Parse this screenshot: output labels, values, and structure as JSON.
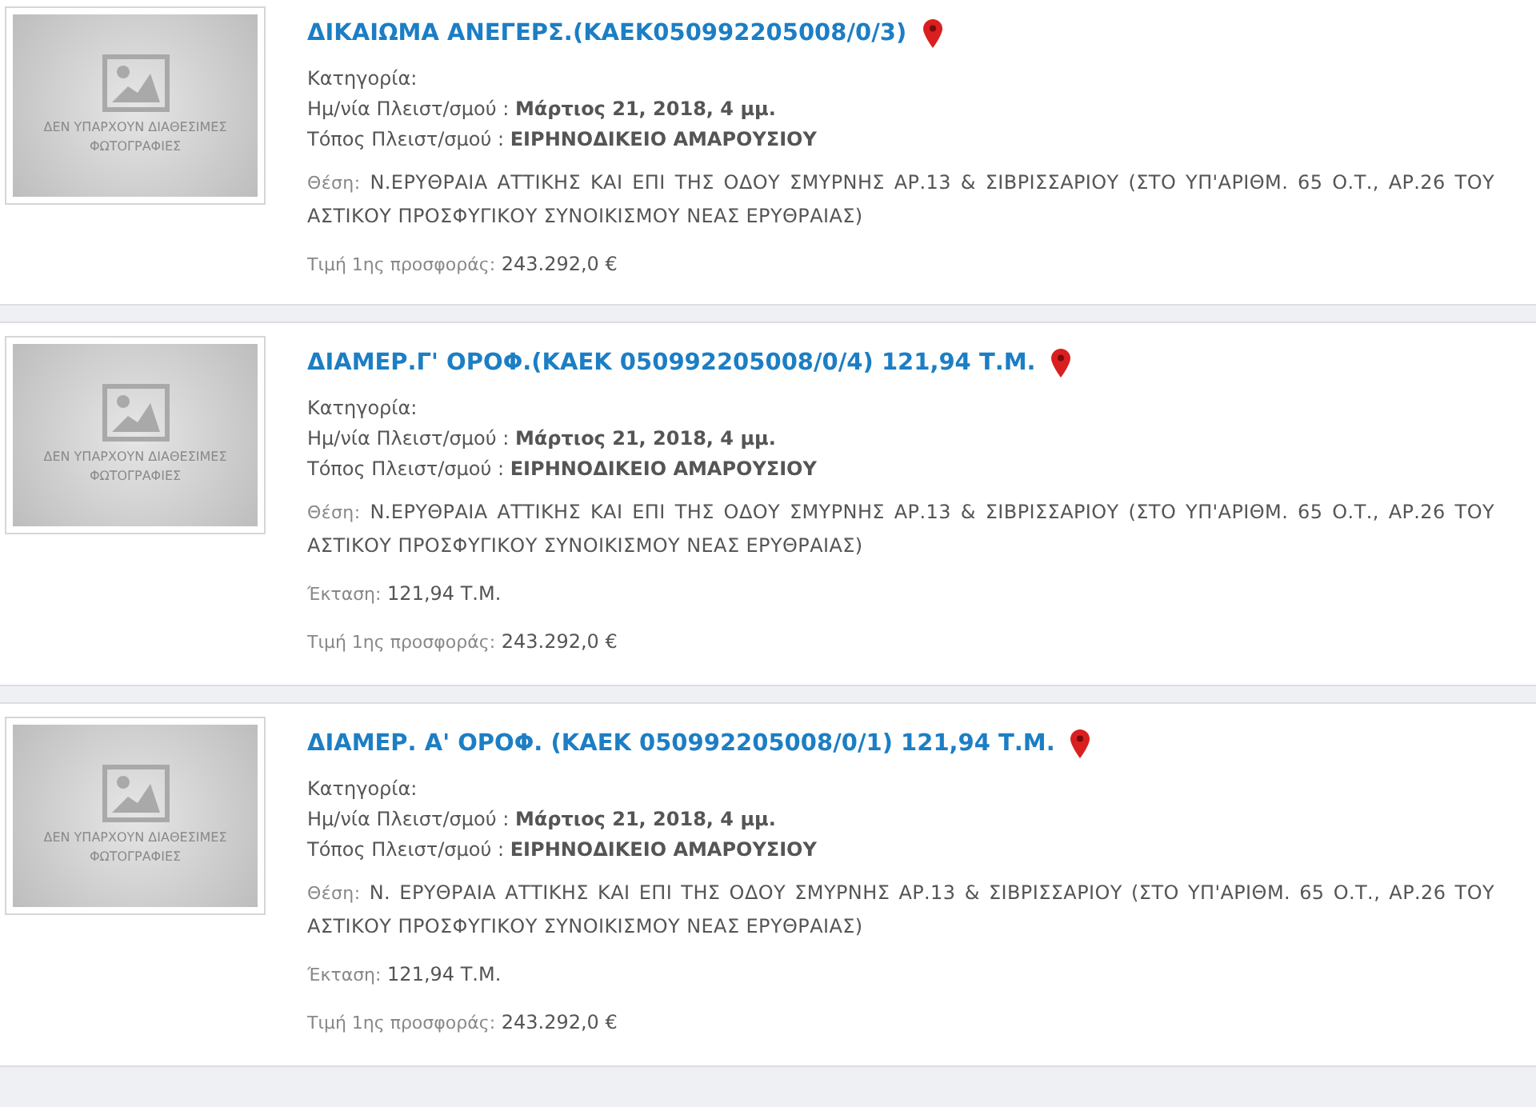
{
  "listings": [
    {
      "placeholder": "ΔΕΝ ΥΠΑΡΧΟΥΝ ΔΙΑΘΕΣΙΜΕΣ ΦΩΤΟΓΡΑΦΙΕΣ",
      "title": "ΔΙΚΑΙΩΜΑ ΑΝΕΓΕΡΣ.(ΚΑΕΚ050992205008/0/3)",
      "info": [
        {
          "label": "Κατηγορία:"
        },
        {
          "label": "Ημ/νία Πλειστ/σμού :",
          "value": "Μάρτιος 21, 2018, 4 μμ."
        },
        {
          "label": "Τόπος Πλειστ/σμού :",
          "value": "ΕΙΡΗΝΟΔΙΚΕΙΟ ΑΜΑΡΟΥΣΙΟΥ"
        }
      ],
      "details": [
        {
          "kind": "address",
          "label": "Θέση:",
          "value": "Ν.ΕΡΥΘΡΑΙΑ ΑΤΤΙΚΗΣ ΚΑΙ ΕΠΙ ΤΗΣ ΟΔΟΥ ΣΜΥΡΝΗΣ ΑΡ.13 & ΣΙΒΡΙΣΣΑΡΙΟΥ (ΣΤΟ ΥΠ'ΑΡΙΘΜ. 65 Ο.Τ., ΑΡ.26 ΤΟΥ ΑΣΤΙΚΟΥ ΠΡΟΣΦΥΓΙΚΟΥ ΣΥΝΟΙΚΙΣΜΟΥ ΝΕΑΣ ΕΡΥΘΡΑΙΑΣ)"
        },
        {
          "kind": "plain",
          "label": "Τιμή 1ης προσφοράς:",
          "value": "243.292,0 €"
        }
      ]
    },
    {
      "placeholder": "ΔΕΝ ΥΠΑΡΧΟΥΝ ΔΙΑΘΕΣΙΜΕΣ ΦΩΤΟΓΡΑΦΙΕΣ",
      "title": "ΔΙΑΜΕΡ.Γ' ΟΡΟΦ.(ΚΑΕΚ 050992205008/0/4) 121,94 Τ.Μ.",
      "info": [
        {
          "label": "Κατηγορία:"
        },
        {
          "label": "Ημ/νία Πλειστ/σμού :",
          "value": "Μάρτιος 21, 2018, 4 μμ."
        },
        {
          "label": "Τόπος Πλειστ/σμού :",
          "value": "ΕΙΡΗΝΟΔΙΚΕΙΟ ΑΜΑΡΟΥΣΙΟΥ"
        }
      ],
      "details": [
        {
          "kind": "address",
          "label": "Θέση:",
          "value": "Ν.ΕΡΥΘΡΑΙΑ ΑΤΤΙΚΗΣ ΚΑΙ ΕΠΙ ΤΗΣ ΟΔΟΥ ΣΜΥΡΝΗΣ ΑΡ.13 & ΣΙΒΡΙΣΣΑΡΙΟΥ (ΣΤΟ ΥΠ'ΑΡΙΘΜ. 65 Ο.Τ., ΑΡ.26 ΤΟΥ ΑΣΤΙΚΟΥ ΠΡΟΣΦΥΓΙΚΟΥ ΣΥΝΟΙΚΙΣΜΟΥ ΝΕΑΣ ΕΡΥΘΡΑΙΑΣ)"
        },
        {
          "kind": "plain",
          "label": "Έκταση:",
          "value": "121,94 Τ.Μ."
        },
        {
          "kind": "plain",
          "label": "Τιμή 1ης προσφοράς:",
          "value": "243.292,0 €"
        }
      ]
    },
    {
      "placeholder": "ΔΕΝ ΥΠΑΡΧΟΥΝ ΔΙΑΘΕΣΙΜΕΣ ΦΩΤΟΓΡΑΦΙΕΣ",
      "title": "ΔΙΑΜΕΡ. Α' ΟΡΟΦ. (ΚΑΕΚ 050992205008/0/1) 121,94 Τ.Μ.",
      "info": [
        {
          "label": "Κατηγορία:"
        },
        {
          "label": "Ημ/νία Πλειστ/σμού :",
          "value": "Μάρτιος 21, 2018, 4 μμ."
        },
        {
          "label": "Τόπος Πλειστ/σμού :",
          "value": "ΕΙΡΗΝΟΔΙΚΕΙΟ ΑΜΑΡΟΥΣΙΟΥ"
        }
      ],
      "details": [
        {
          "kind": "address",
          "label": "Θέση:",
          "value": "Ν. ΕΡΥΘΡΑΙΑ ΑΤΤΙΚΗΣ ΚΑΙ ΕΠΙ ΤΗΣ ΟΔΟΥ ΣΜΥΡΝΗΣ ΑΡ.13 & ΣΙΒΡΙΣΣΑΡΙΟΥ (ΣΤΟ ΥΠ'ΑΡΙΘΜ. 65 Ο.Τ., ΑΡ.26 ΤΟΥ ΑΣΤΙΚΟΥ ΠΡΟΣΦΥΓΙΚΟΥ ΣΥΝΟΙΚΙΣΜΟΥ ΝΕΑΣ ΕΡΥΘΡΑΙΑΣ)"
        },
        {
          "kind": "plain",
          "label": "Έκταση:",
          "value": "121,94 Τ.Μ."
        },
        {
          "kind": "plain",
          "label": "Τιμή 1ης προσφοράς:",
          "value": "243.292,0 €"
        }
      ]
    }
  ]
}
